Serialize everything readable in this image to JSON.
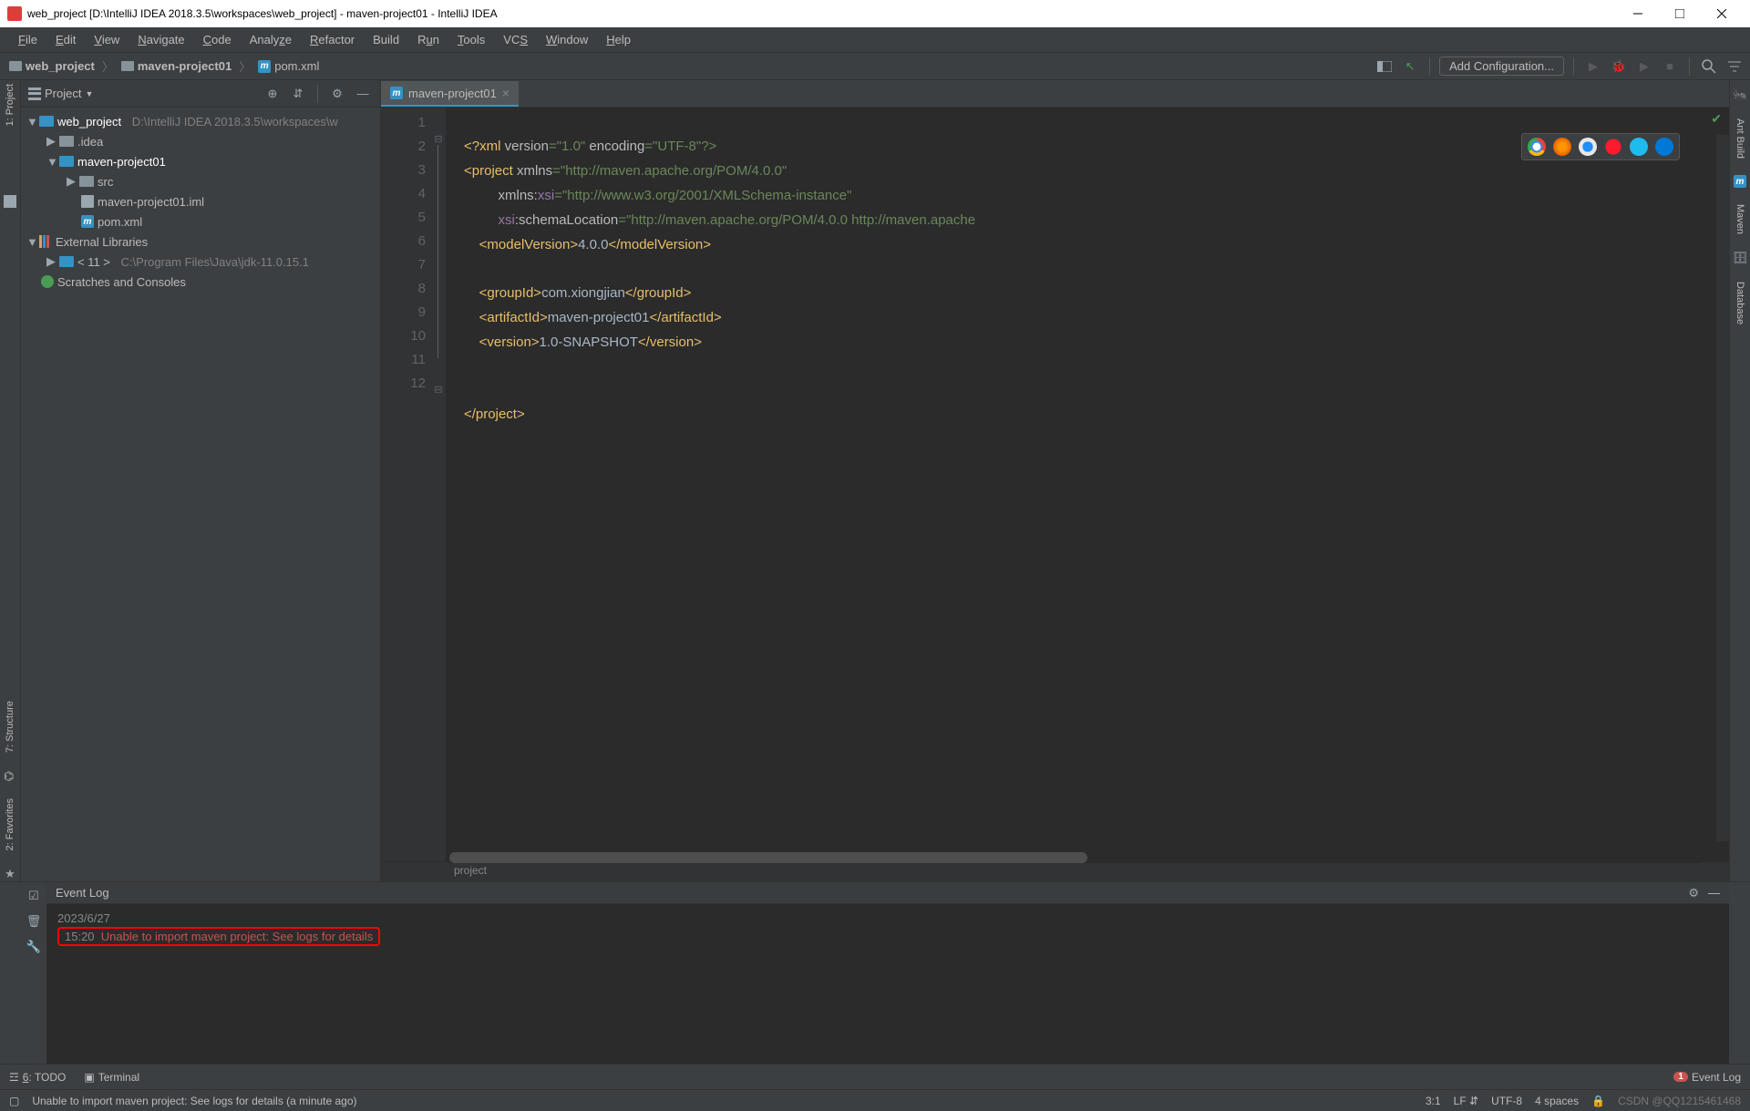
{
  "titlebar": {
    "text": "web_project [D:\\IntelliJ IDEA 2018.3.5\\workspaces\\web_project] - maven-project01 - IntelliJ IDEA"
  },
  "menu": {
    "file": "File",
    "edit": "Edit",
    "view": "View",
    "navigate": "Navigate",
    "code": "Code",
    "analyze": "Analyze",
    "refactor": "Refactor",
    "build": "Build",
    "run": "Run",
    "tools": "Tools",
    "vcs": "VCS",
    "window": "Window",
    "help": "Help"
  },
  "breadcrumbs": {
    "c0": "web_project",
    "c1": "maven-project01",
    "c2": "pom.xml"
  },
  "navright": {
    "addconf": "Add Configuration..."
  },
  "project": {
    "label": "Project",
    "side_label": "1: Project",
    "tree": {
      "root": "web_project",
      "root_path": "D:\\IntelliJ IDEA 2018.3.5\\workspaces\\w",
      "idea": ".idea",
      "module": "maven-project01",
      "src": "src",
      "iml": "maven-project01.iml",
      "pom": "pom.xml",
      "extlib": "External Libraries",
      "jdk": "< 11 >",
      "jdk_path": "C:\\Program Files\\Java\\jdk-11.0.15.1",
      "scratches": "Scratches and Consoles"
    }
  },
  "tabs": {
    "pom": "maven-project01"
  },
  "editor": {
    "lines": [
      "1",
      "2",
      "3",
      "4",
      "5",
      "6",
      "7",
      "8",
      "9",
      "10",
      "11",
      "12"
    ],
    "breadcrumb": "project",
    "code": {
      "l1_a": "<?xml ",
      "l1_b": "version",
      "l1_c": "=\"1.0\" ",
      "l1_d": "encoding",
      "l1_e": "=\"UTF-8\"?>",
      "l2_a": "<project ",
      "l2_b": "xmlns",
      "l2_c": "=\"http://maven.apache.org/POM/4.0.0\"",
      "l3_a": "         xmlns:",
      "l3_b": "xsi",
      "l3_c": "=\"http://www.w3.org/2001/XMLSchema-instance\"",
      "l4_a": "         ",
      "l4_b": "xsi",
      "l4_c": ":schemaLocation",
      "l4_d": "=\"http://maven.apache.org/POM/4.0.0 http://maven.apache",
      "l5_a": "    <modelVersion>",
      "l5_b": "4.0.0",
      "l5_c": "</modelVersion>",
      "l7_a": "    <groupId>",
      "l7_b": "com.xiongjian",
      "l7_c": "</groupId>",
      "l8_a": "    <artifactId>",
      "l8_b": "maven-project01",
      "l8_c": "</artifactId>",
      "l9_a": "    <version>",
      "l9_b": "1.0-SNAPSHOT",
      "l9_c": "</version>",
      "l12": "</project>"
    }
  },
  "eventlog": {
    "title": "Event Log",
    "date": "2023/6/27",
    "time": "15:20",
    "msg": "Unable to import maven project: See logs for details"
  },
  "sidetools": {
    "structure": "7: Structure",
    "favorites": "2: Favorites",
    "antbuild": "Ant Build",
    "maven": "Maven",
    "database": "Database"
  },
  "bottomtools": {
    "todo": "6: TODO",
    "terminal": "Terminal",
    "eventlog": "Event Log",
    "badge": "1"
  },
  "status": {
    "msg": "Unable to import maven project: See logs for details (a minute ago)",
    "pos": "3:1",
    "lf": "LF",
    "enc": "UTF-8",
    "spaces": "4 spaces",
    "watermark": "CSDN @QQ1215461468"
  }
}
